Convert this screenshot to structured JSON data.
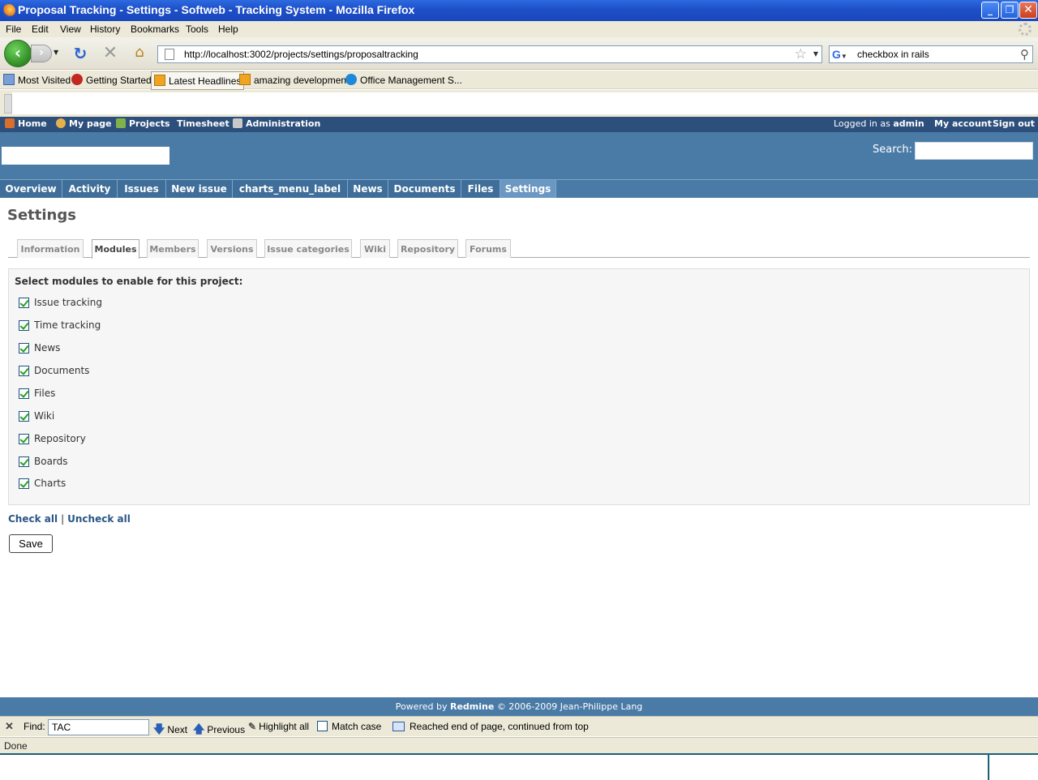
{
  "window": {
    "title": "Proposal Tracking - Settings - Softweb - Tracking System - Mozilla Firefox",
    "minimize": "_",
    "restore": "❐",
    "close": "✕"
  },
  "menubar": [
    "File",
    "Edit",
    "View",
    "History",
    "Bookmarks",
    "Tools",
    "Help"
  ],
  "navbar": {
    "url": "http://localhost:3002/projects/settings/proposaltracking",
    "search_value": "checkbox in rails",
    "search_engine_glyph": "G"
  },
  "bookmarks": [
    "Most Visited",
    "Getting Started",
    "Latest Headlines",
    "amazing development",
    "Office Management S..."
  ],
  "topmenu": {
    "items": [
      "Home",
      "My page",
      "Projects",
      "Timesheet",
      "Administration"
    ],
    "logged_in_prefix": "Logged in as",
    "user": "admin",
    "my_account": "My account",
    "sign_out": "Sign out"
  },
  "header": {
    "search_label": "Search:"
  },
  "mainmenu": [
    "Overview",
    "Activity",
    "Issues",
    "New issue",
    "charts_menu_label",
    "News",
    "Documents",
    "Files",
    "Settings"
  ],
  "page": {
    "heading": "Settings",
    "tabs": [
      "Information",
      "Modules",
      "Members",
      "Versions",
      "Issue categories",
      "Wiki",
      "Repository",
      "Forums"
    ],
    "lead": "Select modules to enable for this project:",
    "modules": [
      "Issue tracking",
      "Time tracking",
      "News",
      "Documents",
      "Files",
      "Wiki",
      "Repository",
      "Boards",
      "Charts"
    ],
    "check_all": "Check all",
    "separator": "|",
    "uncheck_all": "Uncheck all",
    "save": "Save"
  },
  "footer": {
    "prefix": "Powered by",
    "brand": "Redmine",
    "suffix": "© 2006-2009 Jean-Philippe Lang"
  },
  "findbar": {
    "label": "Find:",
    "value": "TAC",
    "next": "Next",
    "previous": "Previous",
    "highlight": "Highlight all",
    "match_case": "Match case",
    "status": "Reached end of page, continued from top"
  },
  "statusbar": {
    "text": "Done"
  },
  "colors": {
    "header_blue": "#4a7ba6",
    "topmenu_blue": "#2c4f7c",
    "link_blue": "#2a5685",
    "check_green": "#21a121"
  }
}
